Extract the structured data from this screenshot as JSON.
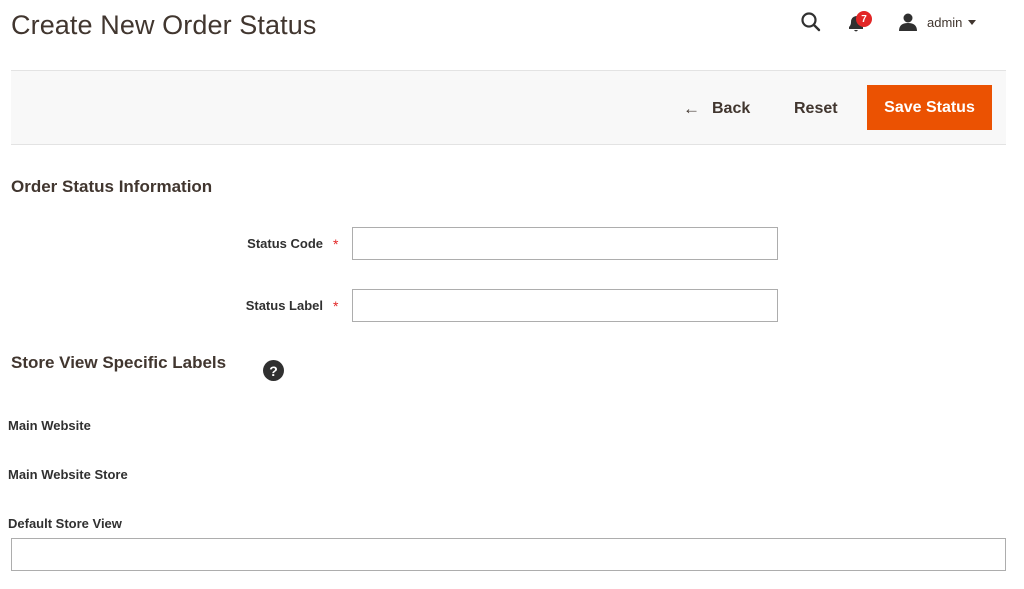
{
  "header": {
    "title": "Create New Order Status",
    "notifications_count": "7",
    "user_name": "admin"
  },
  "toolbar": {
    "back_label": "Back",
    "reset_label": "Reset",
    "save_label": "Save Status"
  },
  "form": {
    "section_title": "Order Status Information",
    "status_code": {
      "label": "Status Code",
      "value": "",
      "required": true
    },
    "status_label": {
      "label": "Status Label",
      "value": "",
      "required": true
    }
  },
  "store_labels": {
    "section_title": "Store View Specific Labels",
    "website": "Main Website",
    "store": "Main Website Store",
    "store_view": "Default Store View",
    "store_view_value": ""
  },
  "colors": {
    "accent": "#eb5202",
    "required": "#e22626",
    "badge": "#e22626",
    "text": "#41362f"
  },
  "icons": [
    "search-icon",
    "bell-icon",
    "user-icon",
    "chevron-down-icon",
    "arrow-left-icon",
    "help-icon"
  ]
}
